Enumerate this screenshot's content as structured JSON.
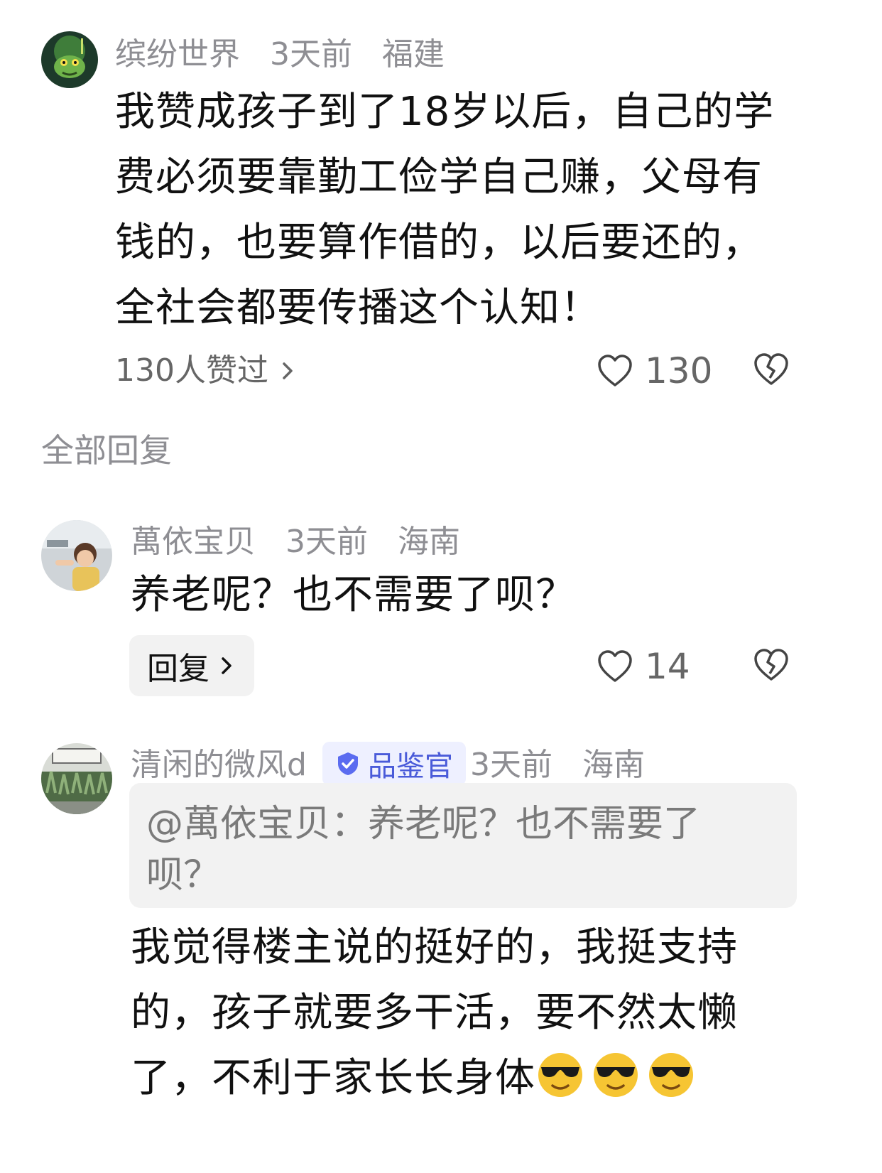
{
  "colors": {
    "text_primary": "#111111",
    "text_muted": "#8e8e93",
    "reply_bg": "#f2f2f2",
    "badge_bg": "#eef0ff",
    "badge_text": "#4a5bd9"
  },
  "main_comment": {
    "avatar_icon": "frog-avatar",
    "username": "缤纷世界",
    "time": "3天前",
    "location": "福建",
    "lines": [
      "我赞成孩子到了18岁以后，自己的学",
      "费必须要靠勤工俭学自己赚，父母有",
      "钱的，也要算作借的，以后要还的，",
      "全社会都要传播这个认知！"
    ],
    "liked_by": "130人赞过",
    "like_count": "130"
  },
  "all_replies_label": "全部回复",
  "replies": [
    {
      "avatar_icon": "child-avatar",
      "username": "萬依宝贝",
      "time": "3天前",
      "location": "海南",
      "text": "养老呢？也不需要了呗？",
      "reply_label": "回复",
      "like_count": "14"
    },
    {
      "avatar_icon": "garden-avatar",
      "username": "清闲的微风d",
      "badge": "品鉴官",
      "time": "3天前",
      "location": "海南",
      "quote_lines": [
        "@萬依宝贝：养老呢？也不需要了",
        "呗？"
      ],
      "lines": [
        "我觉得楼主说的挺好的，我挺支持",
        "的，孩子就要多干活，要不然太懒",
        "了，不利于家长长身体"
      ],
      "emoji_icon": "cool-sunglasses-emoji"
    }
  ]
}
